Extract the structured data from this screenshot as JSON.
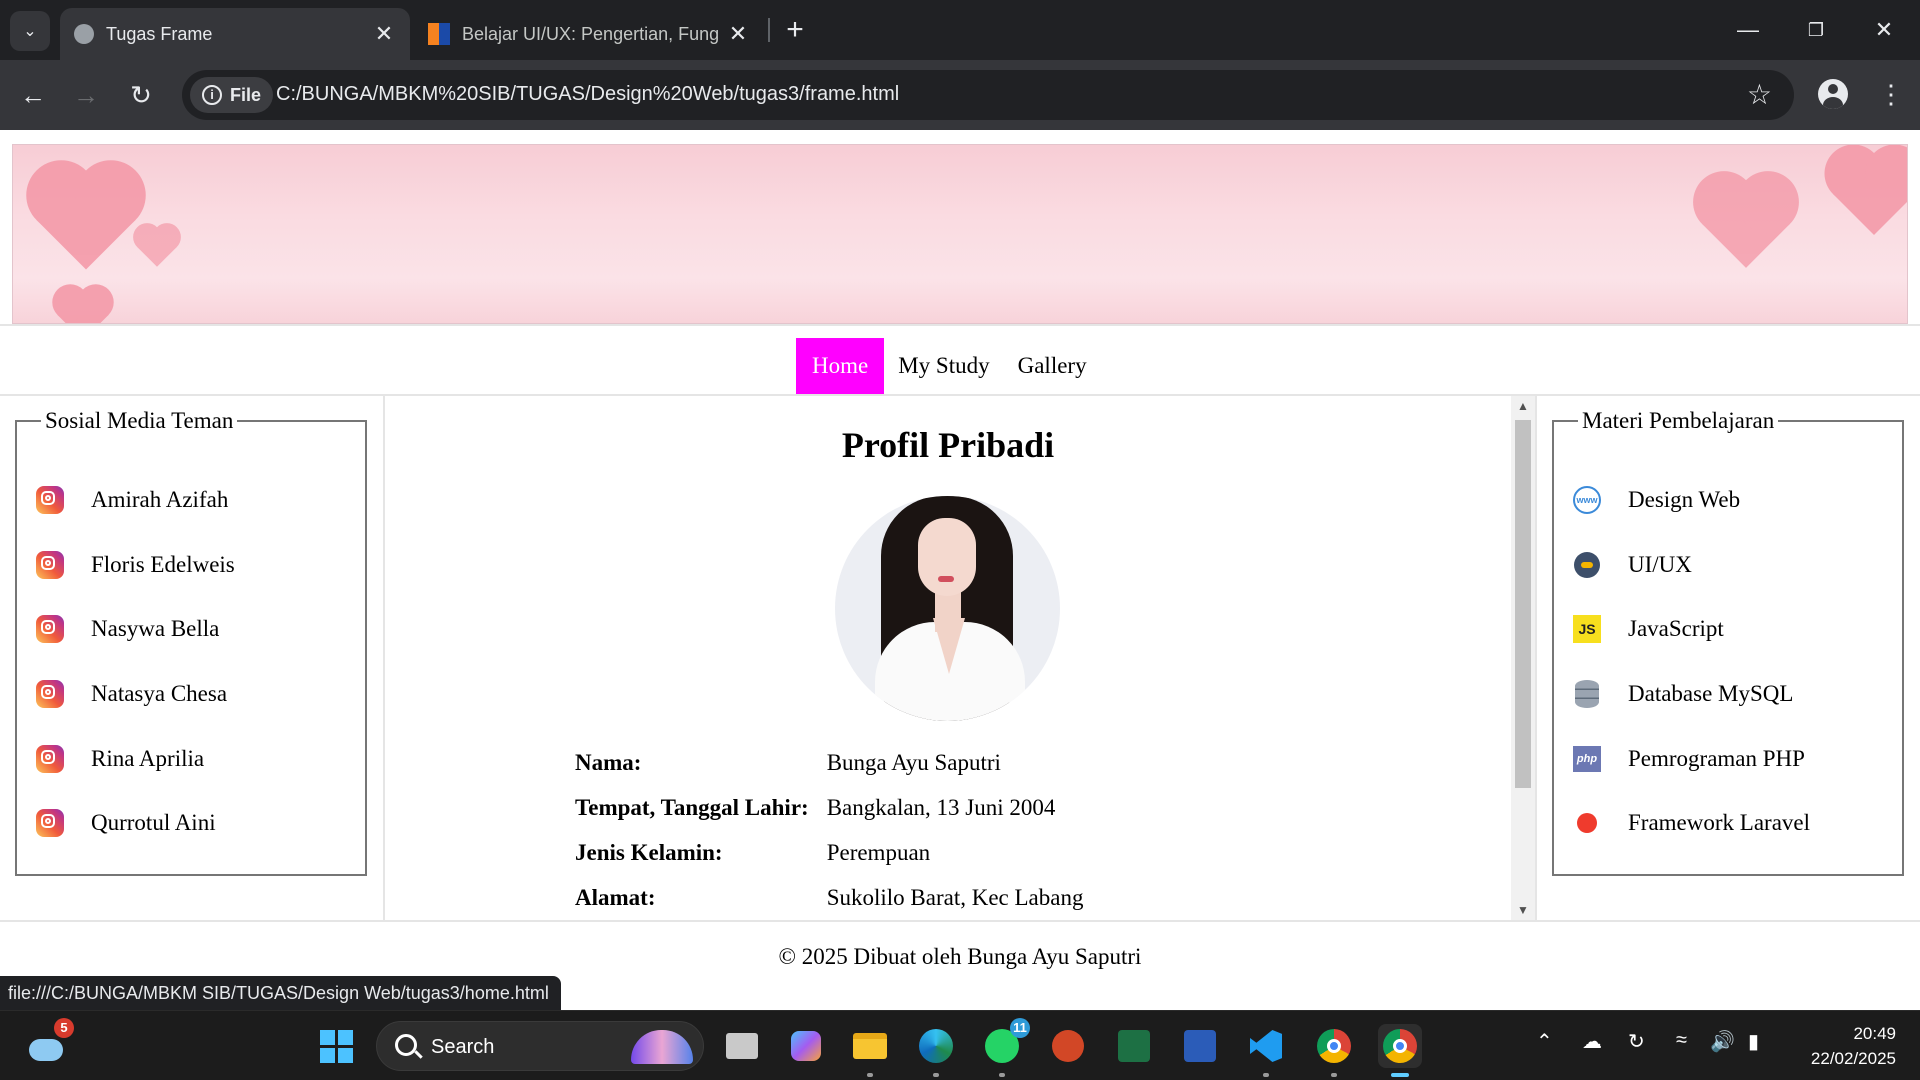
{
  "browser": {
    "tabs": [
      {
        "title": "Tugas Frame",
        "active": true
      },
      {
        "title": "Belajar UI/UX: Pengertian, Fung",
        "active": false
      }
    ],
    "new_tab": "+",
    "address": {
      "chip_label": "File",
      "url": "C:/BUNGA/MBKM%20SIB/TUGAS/Design%20Web/tugas3/frame.html"
    },
    "status_url": "file:///C:/BUNGA/MBKM SIB/TUGAS/Design Web/tugas3/home.html"
  },
  "page": {
    "menu": [
      {
        "label": "Home",
        "active": true
      },
      {
        "label": "My Study",
        "active": false
      },
      {
        "label": "Gallery",
        "active": false
      }
    ],
    "left": {
      "legend": "Sosial Media Teman",
      "items": [
        "Amirah Azifah",
        "Floris Edelweis",
        "Nasywa Bella",
        "Natasya Chesa",
        "Rina Aprilia",
        "Qurrotul Aini"
      ],
      "icon": "instagram-icon"
    },
    "right": {
      "legend": "Materi Pembelajaran",
      "items": [
        {
          "label": "Design Web",
          "icon": "www-globe-icon"
        },
        {
          "label": "UI/UX",
          "icon": "uiux-icon"
        },
        {
          "label": "JavaScript",
          "icon": "javascript-icon",
          "icon_text": "JS"
        },
        {
          "label": "Database MySQL",
          "icon": "database-icon"
        },
        {
          "label": "Pemrograman PHP",
          "icon": "php-icon",
          "icon_text": "php"
        },
        {
          "label": "Framework Laravel",
          "icon": "laravel-icon"
        }
      ]
    },
    "profile": {
      "title": "Profil Pribadi",
      "rows": [
        {
          "label": "Nama:",
          "value": "Bunga Ayu Saputri"
        },
        {
          "label": "Tempat, Tanggal Lahir:",
          "value": "Bangkalan, 13 Juni 2004"
        },
        {
          "label": "Jenis Kelamin:",
          "value": "Perempuan"
        },
        {
          "label": "Alamat:",
          "value": "Sukolilo Barat, Kec Labang"
        }
      ]
    },
    "footer": "© 2025 Dibuat oleh Bunga Ayu Saputri"
  },
  "taskbar": {
    "weather_badge": "5",
    "search_label": "Search",
    "whatsapp_badge": "11",
    "time": "20:49",
    "date": "22/02/2025"
  },
  "colors": {
    "menu_active_bg": "#ff00ff",
    "browser_bg": "#202124",
    "toolbar_bg": "#35363a"
  }
}
